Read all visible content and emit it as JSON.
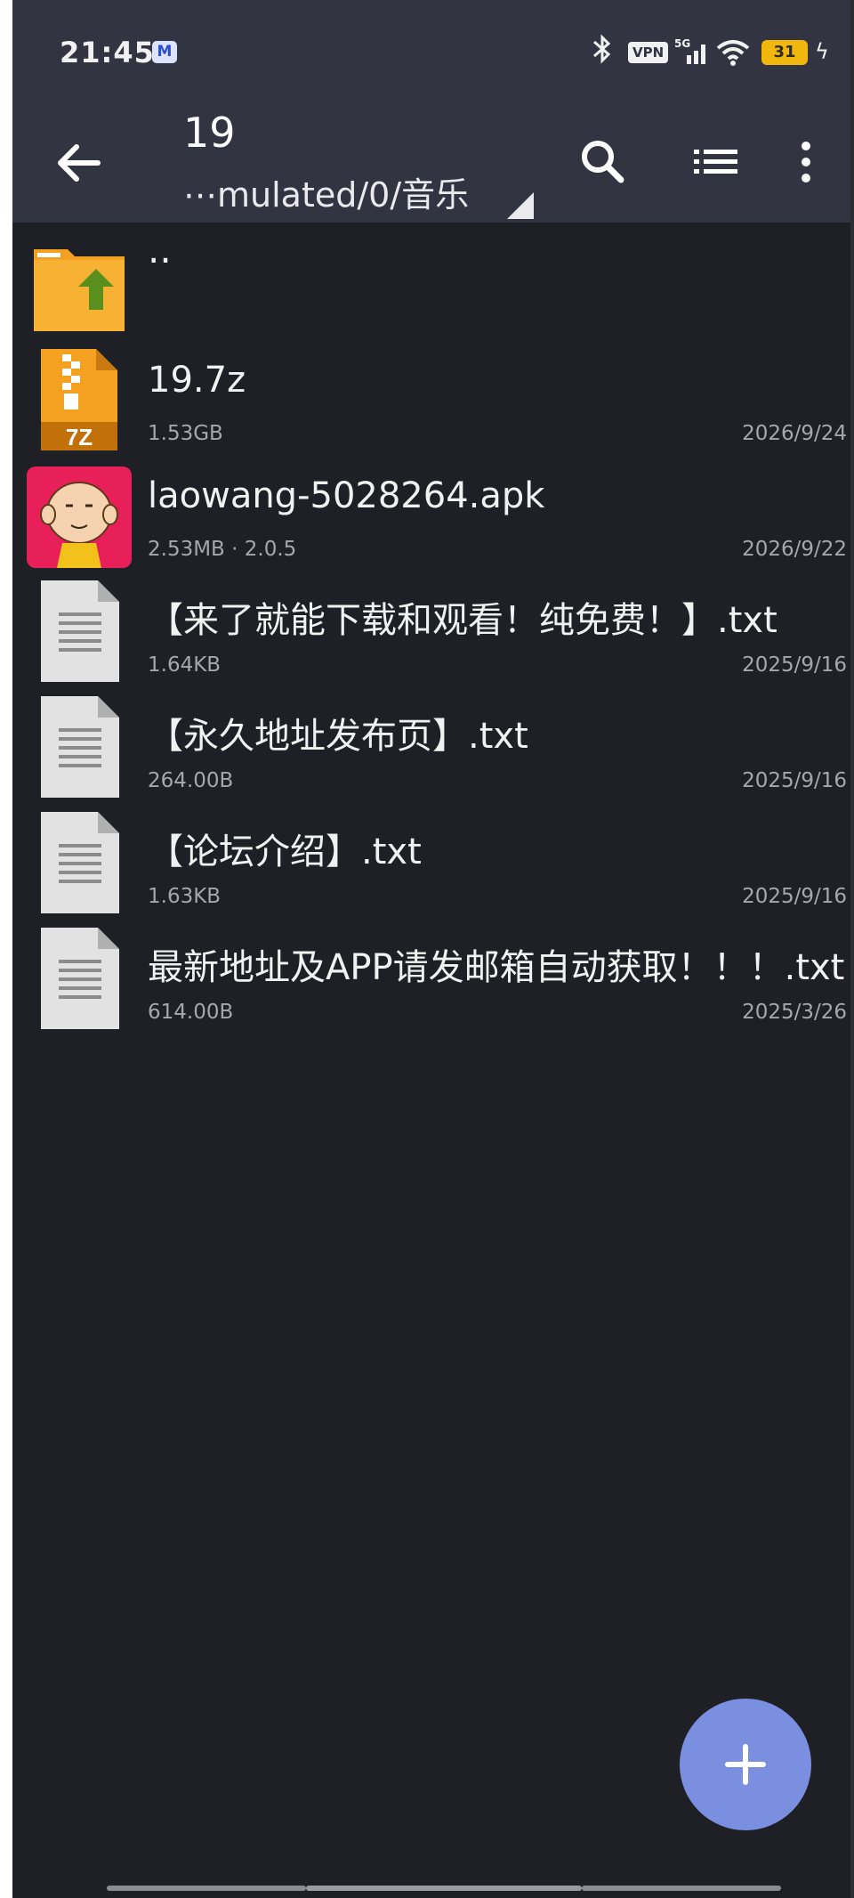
{
  "status_bar": {
    "time": "21:45",
    "mail_app_letter": "M",
    "vpn_label": "VPN",
    "network": "5G",
    "battery": "31"
  },
  "toolbar": {
    "title": "19",
    "path": "⋯mulated/0/音乐",
    "icons": [
      "back-arrow-icon",
      "search-icon",
      "list-view-icon",
      "more-vert-icon"
    ]
  },
  "files": [
    {
      "name": "..",
      "size": "",
      "date": "",
      "icon": "folder-up-icon"
    },
    {
      "name": "19.7z",
      "size": "1.53GB",
      "date": "2026/9/24",
      "icon": "7z-archive-icon"
    },
    {
      "name": "laowang-5028264.apk",
      "size": "2.53MB  · 2.0.5",
      "date": "2026/9/22",
      "icon": "apk-app-icon"
    },
    {
      "name": "【来了就能下载和观看！纯免费！】.txt",
      "size": "1.64KB",
      "date": "2025/9/16",
      "icon": "text-file-icon"
    },
    {
      "name": "【永久地址发布页】.txt",
      "size": "264.00B",
      "date": "2025/9/16",
      "icon": "text-file-icon"
    },
    {
      "name": "【论坛介绍】.txt",
      "size": "1.63KB",
      "date": "2025/9/16",
      "icon": "text-file-icon"
    },
    {
      "name": "最新地址及APP请发邮箱自动获取！！！.txt",
      "size": "614.00B",
      "date": "2025/3/26",
      "icon": "text-file-icon"
    }
  ],
  "fab": {
    "icon": "plus-icon"
  },
  "colors": {
    "toolbar_bg": "#323541",
    "list_bg": "#1f2025",
    "folder_orange": "#f4a020",
    "fab_blue": "#7b8fe0",
    "apk_bg": "#e8205a"
  }
}
